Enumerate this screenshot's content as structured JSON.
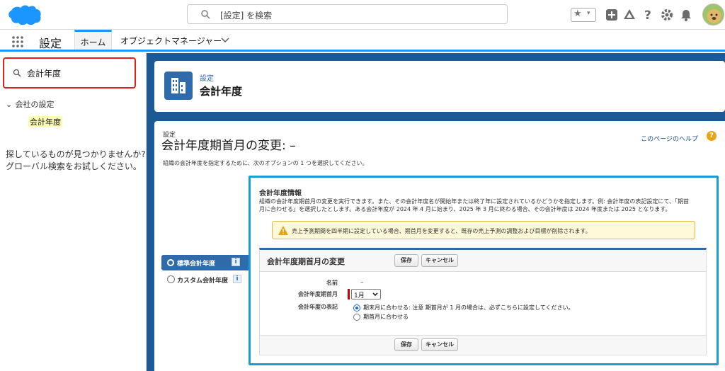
{
  "header": {
    "search_placeholder": "[設定] を検索",
    "brand_color": "#1b96ff",
    "icons": [
      "favorites-star-icon",
      "favorites-dropdown-icon",
      "global-add-icon",
      "trailhead-icon",
      "help-icon",
      "setup-gear-icon",
      "notification-bell-icon",
      "user-avatar"
    ]
  },
  "nav": {
    "app_name": "設定",
    "tabs": [
      {
        "label": "ホーム",
        "active": true
      },
      {
        "label": "オブジェクトマネージャー",
        "active": false
      }
    ]
  },
  "sidebar": {
    "quickfind_value": "会計年度",
    "section": "会社の設定",
    "item": "会計年度",
    "no_result_text_1": "探しているものが見つかりませんか?",
    "no_result_text_2": "グローバル検索をお試しください。"
  },
  "page_header": {
    "subtitle": "設定",
    "title": "会計年度"
  },
  "content": {
    "breadcrumb": "設定",
    "title": "会計年度期首月の変更: –",
    "help_link": "このページのヘルプ",
    "description": "組織の会計年度を指定するために、次のオプションの 1 つを選択してください。",
    "options": [
      {
        "label": "標準会計年度",
        "selected": true
      },
      {
        "label": "カスタム会計年度",
        "selected": false
      }
    ],
    "info_icon": "i",
    "panel": {
      "title": "会計年度情報",
      "desc_line1": "組織の会計年度期首月の変更を実行できます。また、その会計年度名が開始年または終了年に設定されているかどうかを指定します。例: 会計年度の表記設定にて、「期首",
      "desc_line2": "月に合わせる」を選択したとします。ある会計年度が 2024 年 4 月に始まり、2025 年 3 月に終わる場合、その会計年度は 2024 年度または 2025 となります。",
      "warning": "売上予測期間を四半期に設定している場合、期首月を変更すると、既存の売上予測の調整および目標が削除されます。",
      "section_title": "会計年度期首月の変更",
      "save": "保存",
      "cancel": "キャンセル",
      "field_name_label": "名前",
      "field_name_value": "–",
      "field_month_label": "会計年度期首月",
      "field_month_value": "1月",
      "field_display_label": "会計年度の表記",
      "display_options": [
        {
          "label": "期末月に合わせる: 注意 期首月が 1 月の場合は、必ずこちらに設定してください。",
          "selected": true
        },
        {
          "label": "期首月に合わせる",
          "selected": false
        }
      ]
    }
  }
}
